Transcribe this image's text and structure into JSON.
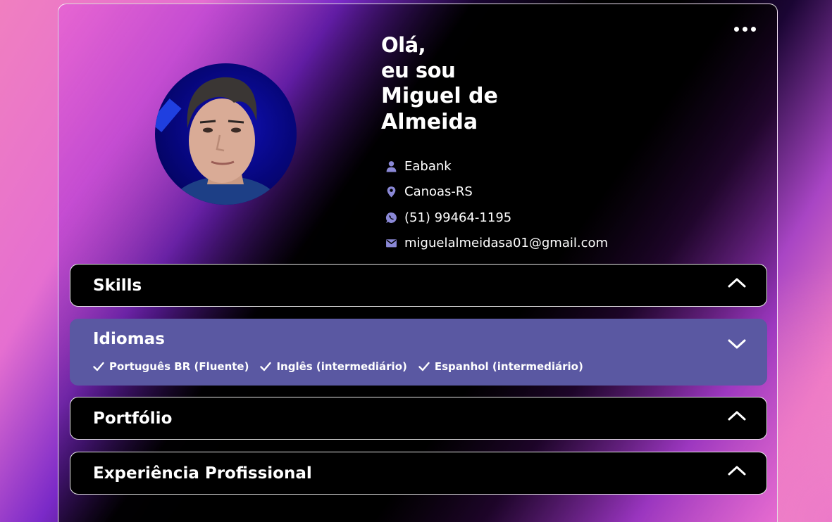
{
  "profile": {
    "greeting_line1": "Olá,",
    "greeting_line2": "eu sou",
    "name_line1": "Miguel de",
    "name_line2": "Almeida"
  },
  "contacts": {
    "company": "Eabank",
    "location": "Canoas-RS",
    "phone": "(51) 99464-1195",
    "email": "miguelalmeidasa01@gmail.com"
  },
  "accordions": [
    {
      "title": "Skills",
      "expanded": false
    },
    {
      "title": "Idiomas",
      "expanded": true
    },
    {
      "title": "Portfólio",
      "expanded": false
    },
    {
      "title": "Experiência Profissional",
      "expanded": false
    }
  ],
  "languages": [
    "Português BR (Fluente)",
    "Inglês (intermediário)",
    "Espanhol (intermediário)"
  ],
  "colors": {
    "accent": "#5a58a2",
    "icon": "#8a88d6"
  },
  "icons": {
    "menu": "more-dots-icon",
    "company": "user-icon",
    "location": "map-pin-icon",
    "phone": "whatsapp-icon",
    "email": "mail-icon"
  }
}
